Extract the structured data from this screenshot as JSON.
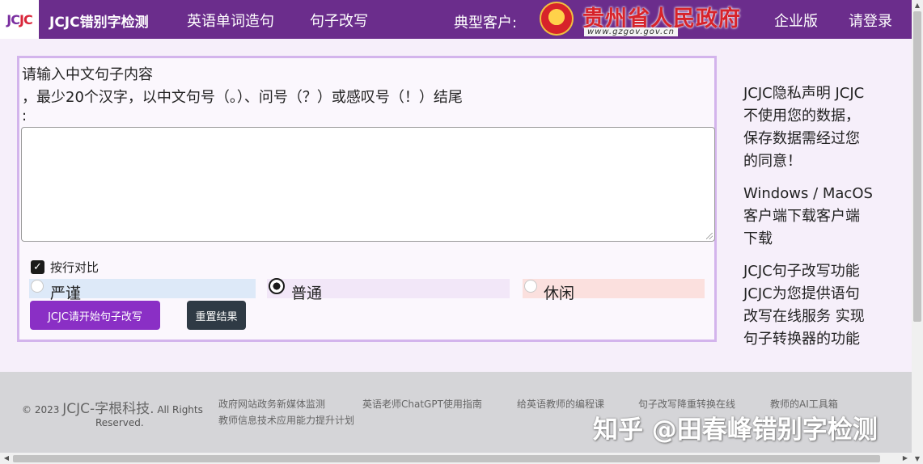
{
  "nav": {
    "logo": "JCJC",
    "brand": "JCJC错别字检测",
    "links": [
      "英语单词造句",
      "句子改写"
    ],
    "customer_label": "典型客户:",
    "gov_title": "贵州省人民政府",
    "gov_url": "www.gzgov.gov.cn",
    "enterprise": "企业版",
    "login": "请登录"
  },
  "form": {
    "prompt_line1": "请输入中文句子内容",
    "prompt_line2": "，最少20个汉字，以中文句号（。）、问号（？）或感叹号（！）结尾",
    "prompt_line3": ":",
    "textarea_value": "",
    "compare_checked": true,
    "compare_label": "按行对比",
    "modes": [
      {
        "label": "严谨",
        "selected": false,
        "bg": "#dde9f8"
      },
      {
        "label": "普通",
        "selected": true,
        "bg": "#f2e7f8"
      },
      {
        "label": "休闲",
        "selected": false,
        "bg": "#fbe0de"
      }
    ],
    "submit_button": "JCJC请开始句子改写",
    "reset_button": "重置结果"
  },
  "sidebar": {
    "privacy": [
      "JCJC隐私声明 JCJC",
      "不使用您的数据，",
      "保存数据需经过您",
      "的同意！"
    ],
    "download": [
      "Windows / MacOS",
      "客户端下载客户端",
      "下载"
    ],
    "feature": [
      "JCJC句子改写功能",
      "JCJC为您提供语句",
      "改写在线服务 实现",
      "句子转换器的功能"
    ]
  },
  "footer": {
    "copyright_prefix": "© 2023",
    "company": "JCJC-字根科技.",
    "rights": "All Rights",
    "reserved": "Reserved.",
    "links": [
      "政府网站政务新媒体监测",
      "英语老师ChatGPT使用指南",
      "给英语教师的编程课",
      "句子改写降重转换在线",
      "教师的AI工具箱",
      "教师信息技术应用能力提升计划"
    ],
    "watermark": "知乎 @田春峰错别字检测"
  }
}
